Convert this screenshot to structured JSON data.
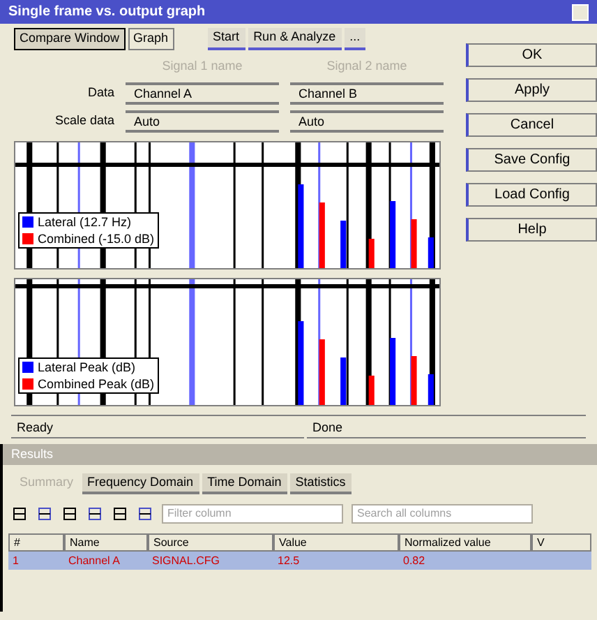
{
  "window": {
    "title": "Single frame vs. output graph"
  },
  "toolbar": {
    "tabs": [
      {
        "label": "Compare Window",
        "selected": true
      },
      {
        "label": "Graph",
        "selected": false
      }
    ],
    "buttons": [
      "Start",
      "Run & Analyze",
      "..."
    ]
  },
  "fields": {
    "columns": [
      "Signal 1 name",
      "Signal 2 name"
    ],
    "rows": [
      {
        "label": "Data",
        "values": [
          "Channel A",
          "Channel B"
        ]
      },
      {
        "label": "Scale data",
        "values": [
          "Auto",
          "Auto"
        ]
      }
    ]
  },
  "charts": [
    {
      "legend": [
        {
          "label": "Lateral (12.7 Hz)",
          "color": "#0000ff"
        },
        {
          "label": "Combined (-15.0 dB)",
          "color": "#ff0000"
        }
      ]
    },
    {
      "legend": [
        {
          "label": "Lateral Peak (dB)",
          "color": "#0000ff"
        },
        {
          "label": "Combined Peak (dB)",
          "color": "#ff0000"
        }
      ]
    }
  ],
  "side_buttons": [
    "OK",
    "Apply",
    "Cancel",
    "Save Config",
    "Load Config",
    "Help"
  ],
  "status_bar": [
    "Ready",
    "Done"
  ],
  "results": {
    "title": "Results",
    "tabs": [
      {
        "label": "Summary",
        "selected": true
      },
      {
        "label": "Frequency Domain",
        "selected": false
      },
      {
        "label": "Time Domain",
        "selected": false
      },
      {
        "label": "Statistics",
        "selected": false
      }
    ],
    "toolbar_fields": [
      {
        "placeholder": "Filter column"
      },
      {
        "placeholder": "Search all columns"
      }
    ],
    "table": {
      "columns": [
        "#",
        "Name",
        "Source",
        "Value",
        "Normalized value",
        "V"
      ],
      "rows": [
        {
          "selected": true,
          "cells": [
            "1",
            "Channel A",
            "SIGNAL.CFG",
            "12.5",
            "0.82",
            ""
          ]
        }
      ]
    }
  }
}
